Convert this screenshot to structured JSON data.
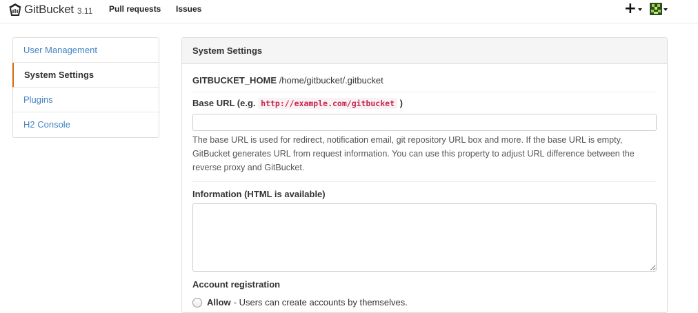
{
  "app": {
    "name": "GitBucket",
    "version": "3.11"
  },
  "nav": {
    "pull_requests": "Pull requests",
    "issues": "Issues",
    "plus_icon": "+"
  },
  "sidebar": {
    "items": [
      {
        "label": "User Management"
      },
      {
        "label": "System Settings"
      },
      {
        "label": "Plugins"
      },
      {
        "label": "H2 Console"
      }
    ]
  },
  "panel": {
    "title": "System Settings",
    "home_label": "GITBUCKET_HOME",
    "home_value": "/home/gitbucket/.gitbucket",
    "base_url": {
      "label_prefix": "Base URL (e.g.",
      "example": "http://example.com/gitbucket",
      "label_suffix": ")",
      "value": "",
      "help": "The base URL is used for redirect, notification email, git repository URL box and more. If the base URL is empty, GitBucket generates URL from request information. You can use this property to adjust URL difference between the reverse proxy and GitBucket."
    },
    "information": {
      "label": "Information (HTML is available)",
      "value": ""
    },
    "account_registration": {
      "label": "Account registration",
      "options": [
        {
          "strong": "Allow",
          "description": "- Users can create accounts by themselves."
        }
      ]
    }
  },
  "colors": {
    "link": "#4183c4",
    "active_marker": "#d26911",
    "code_text": "#c7254e"
  }
}
